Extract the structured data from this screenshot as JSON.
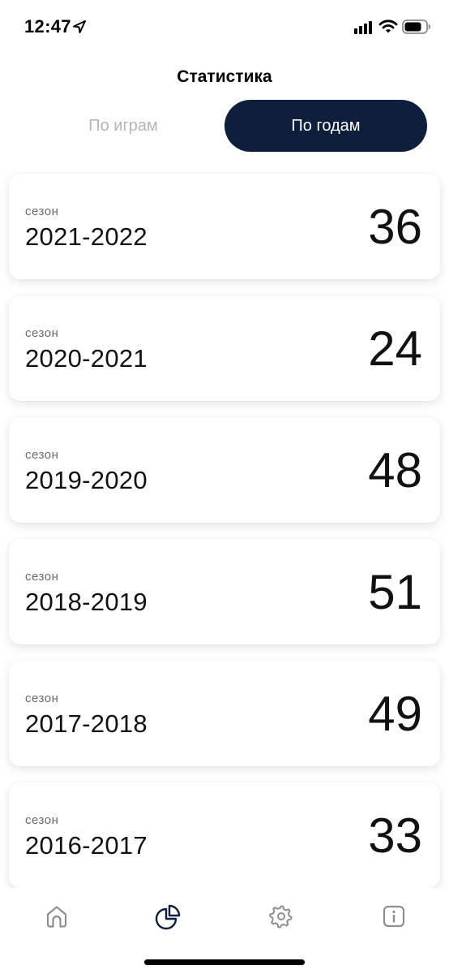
{
  "status_bar": {
    "time": "12:47",
    "icons": [
      "location-arrow-icon",
      "signal-icon",
      "wifi-icon",
      "battery-icon"
    ]
  },
  "header": {
    "title": "Статистика"
  },
  "tabs": [
    {
      "label": "По играм",
      "active": false
    },
    {
      "label": "По годам",
      "active": true
    }
  ],
  "seasons": [
    {
      "caption": "сезон",
      "season": "2021-2022",
      "count": "36"
    },
    {
      "caption": "сезон",
      "season": "2020-2021",
      "count": "24"
    },
    {
      "caption": "сезон",
      "season": "2019-2020",
      "count": "48"
    },
    {
      "caption": "сезон",
      "season": "2018-2019",
      "count": "51"
    },
    {
      "caption": "сезон",
      "season": "2017-2018",
      "count": "49"
    },
    {
      "caption": "сезон",
      "season": "2016-2017",
      "count": "33"
    }
  ],
  "bottom_nav": [
    {
      "icon": "home-icon",
      "active": false
    },
    {
      "icon": "pie-chart-icon",
      "active": true
    },
    {
      "icon": "gear-icon",
      "active": false
    },
    {
      "icon": "info-icon",
      "active": false
    }
  ],
  "colors": {
    "accent": "#0e1f3d",
    "inactive_tab_text": "#b4b4bb",
    "inactive_icon": "#8e8e93",
    "background": "#ffffff"
  }
}
